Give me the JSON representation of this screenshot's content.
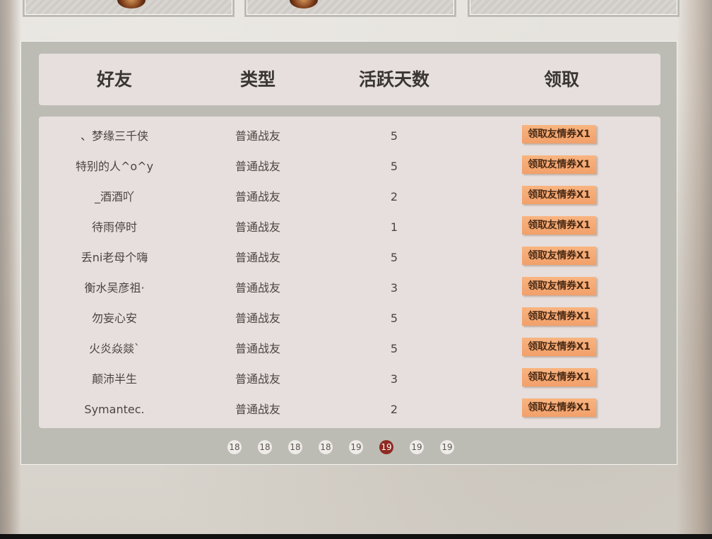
{
  "columns": {
    "friend": "好友",
    "type": "类型",
    "active_days": "活跃天数",
    "claim": "领取"
  },
  "rows": [
    {
      "name": "、梦缘三千侠",
      "type": "普通战友",
      "days": "5",
      "action": "领取友情券X1"
    },
    {
      "name": "特别的人^o^y",
      "type": "普通战友",
      "days": "5",
      "action": "领取友情券X1"
    },
    {
      "name": "_酒酒吖",
      "type": "普通战友",
      "days": "2",
      "action": "领取友情券X1"
    },
    {
      "name": "待雨停时",
      "type": "普通战友",
      "days": "1",
      "action": "领取友情券X1"
    },
    {
      "name": "丢ni老母个嗨",
      "type": "普通战友",
      "days": "5",
      "action": "领取友情券X1"
    },
    {
      "name": "衡水吴彦祖·",
      "type": "普通战友",
      "days": "3",
      "action": "领取友情券X1"
    },
    {
      "name": "勿妄心安",
      "type": "普通战友",
      "days": "5",
      "action": "领取友情券X1"
    },
    {
      "name": "火炎焱燚`",
      "type": "普通战友",
      "days": "5",
      "action": "领取友情券X1"
    },
    {
      "name": "颠沛半生",
      "type": "普通战友",
      "days": "3",
      "action": "领取友情券X1"
    },
    {
      "name": "Symantec.",
      "type": "普通战友",
      "days": "2",
      "action": "领取友情券X1"
    }
  ],
  "pagination": {
    "pages": [
      "18",
      "18",
      "18",
      "18",
      "19",
      "19",
      "19",
      "19"
    ],
    "active_index": 5
  },
  "colors": {
    "panel": "#bcbcb4",
    "table_bg": "#e7dfdd",
    "button": "#f2a06a",
    "active_page": "#8e2a22"
  }
}
